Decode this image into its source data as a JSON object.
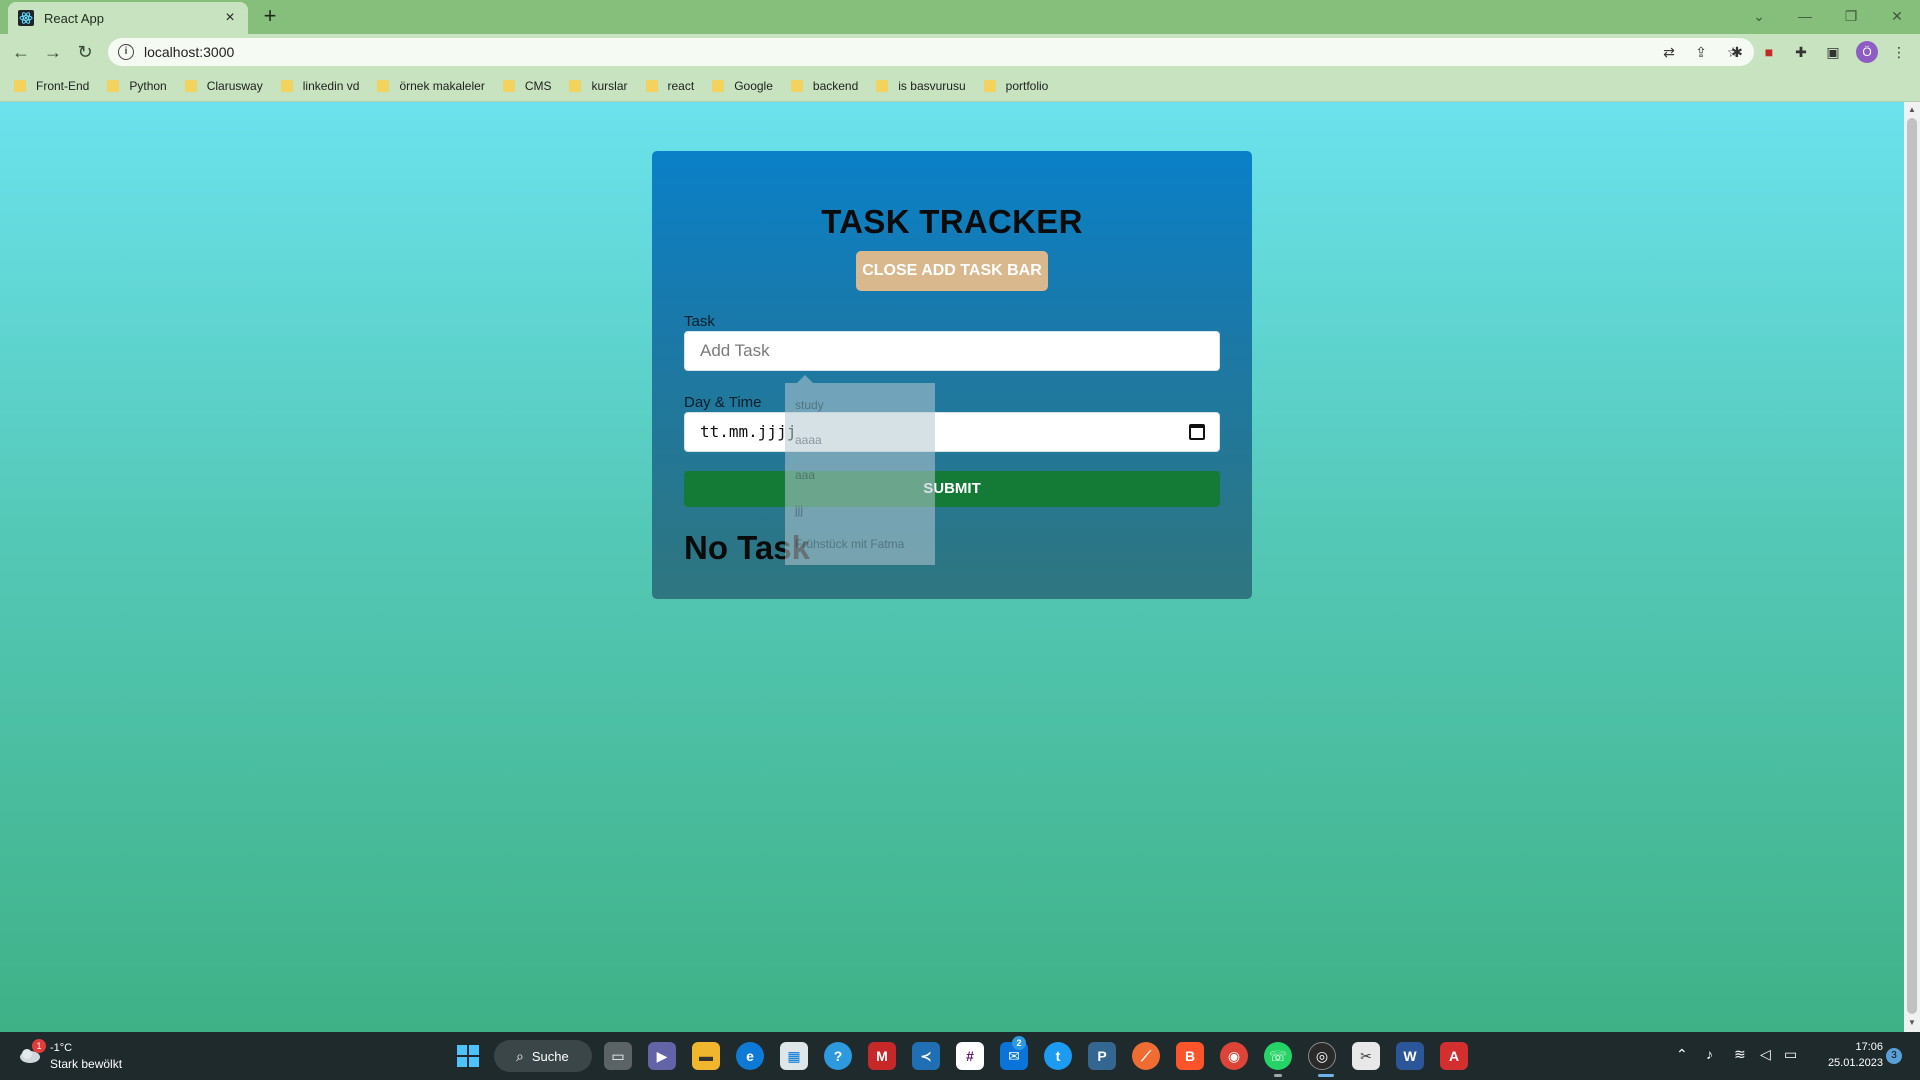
{
  "browser": {
    "tab_title": "React App",
    "tab_close": "×",
    "new_tab": "+",
    "url": "localhost:3000",
    "bookmarks": [
      "Front-End",
      "Python",
      "Clarusway",
      "linkedin vd",
      "örnek makaleler",
      "CMS",
      "kurslar",
      "react",
      "Google",
      "backend",
      "is basvurusu",
      "portfolio"
    ],
    "profile_initial": "Ö"
  },
  "app": {
    "title": "TASK TRACKER",
    "toggle_label": "CLOSE ADD TASK BAR",
    "task_label": "Task",
    "task_placeholder": "Add Task",
    "date_label": "Day & Time",
    "date_value": "tt.mm.jjjj",
    "submit_label": "SUBMIT",
    "empty_message": "No Task",
    "suggestions": [
      "study",
      "aaaa",
      "aaa",
      "jjj",
      "Frühstück mit Fatma"
    ]
  },
  "taskbar": {
    "weather_temp": "-1°C",
    "weather_desc": "Stark bewölkt",
    "weather_badge": "1",
    "search_label": "Suche",
    "time": "17:06",
    "date": "25.01.2023",
    "notification_count": "3",
    "mail_badge": "2"
  }
}
